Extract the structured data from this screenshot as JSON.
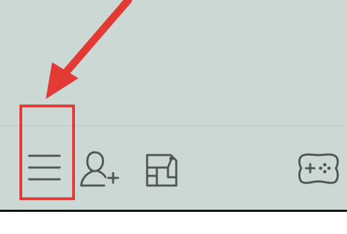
{
  "toolbar": {
    "items": [
      {
        "icon": "hamburger-menu-icon"
      },
      {
        "icon": "add-friend-icon"
      },
      {
        "icon": "gallery-icon"
      },
      {
        "icon": "gamepad-icon"
      }
    ]
  },
  "annotation": {
    "highlight_color": "#e23a35",
    "highlighted_item": "hamburger-menu-icon"
  },
  "colors": {
    "app_background": "#ccd8d4",
    "icon_stroke": "#4f5653",
    "annotation": "#e23a35"
  }
}
